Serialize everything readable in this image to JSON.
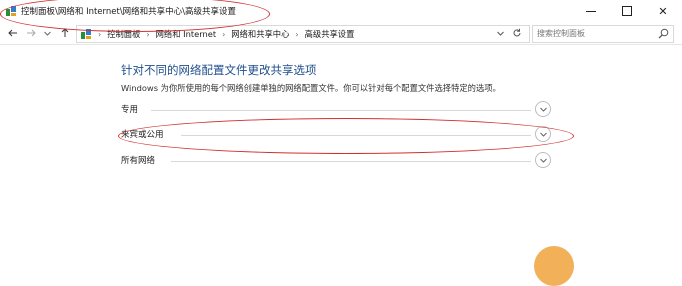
{
  "window": {
    "title": "控制面板\\网络和 Internet\\网络和共享中心\\高级共享设置",
    "minimize_label": "—",
    "maximize_label": "□",
    "close_label": "✕"
  },
  "nav": {
    "back_icon": "arrow-left-icon",
    "forward_icon": "arrow-right-icon",
    "up_icon": "arrow-up-icon",
    "refresh_icon": "refresh-icon",
    "breadcrumbs": [
      "控制面板",
      "网络和 Internet",
      "网络和共享中心",
      "高级共享设置"
    ],
    "search_placeholder": "搜索控制面板"
  },
  "content": {
    "heading": "针对不同的网络配置文件更改共享选项",
    "description": "Windows 为你所使用的每个网络创建单独的网络配置文件。你可以针对每个配置文件选择特定的选项。",
    "sections": [
      {
        "label": "专用"
      },
      {
        "label": "来宾或公用"
      },
      {
        "label": "所有网络"
      }
    ]
  },
  "colors": {
    "heading": "#1e4e8c",
    "annotation": "#d03030"
  }
}
